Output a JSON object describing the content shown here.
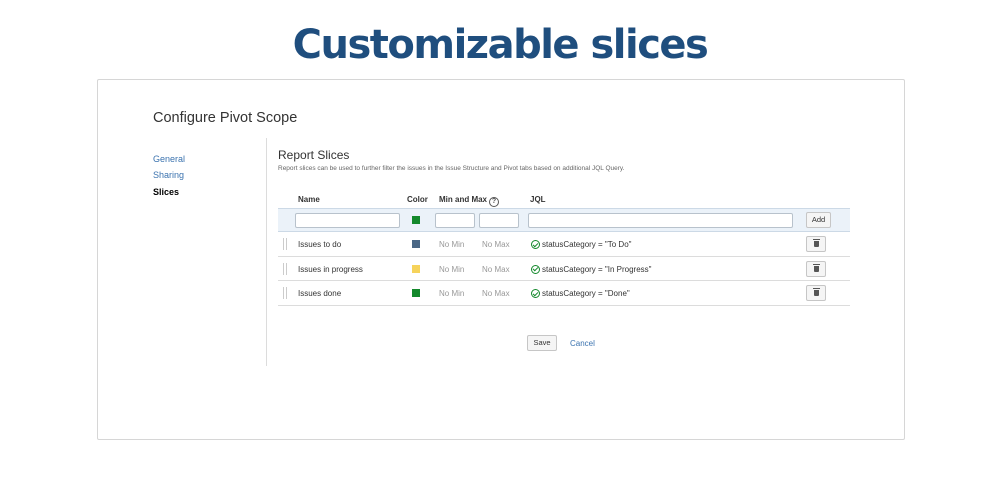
{
  "hero": {
    "title": "Customizable slices"
  },
  "page": {
    "heading": "Configure Pivot Scope"
  },
  "nav": {
    "items": [
      {
        "label": "General",
        "active": false
      },
      {
        "label": "Sharing",
        "active": false
      },
      {
        "label": "Slices",
        "active": true
      }
    ]
  },
  "section": {
    "title": "Report Slices",
    "description": "Report slices can be used to further filter the issues in the Issue Structure and Pivot tabs based on additional JQL Query."
  },
  "table": {
    "headers": {
      "name": "Name",
      "color": "Color",
      "minmax": "Min and Max",
      "jql": "JQL"
    },
    "new_row": {
      "name": "",
      "color": "#14892c",
      "min": "",
      "max": "",
      "jql": "",
      "add_label": "Add"
    },
    "rows": [
      {
        "name": "Issues to do",
        "color": "#4a6785",
        "min": "No Min",
        "max": "No Max",
        "jql": "statusCategory = \"To Do\""
      },
      {
        "name": "Issues in progress",
        "color": "#f6d35b",
        "min": "No Min",
        "max": "No Max",
        "jql": "statusCategory = \"In Progress\""
      },
      {
        "name": "Issues done",
        "color": "#14892c",
        "min": "No Min",
        "max": "No Max",
        "jql": "statusCategory = \"Done\""
      }
    ]
  },
  "actions": {
    "save_label": "Save",
    "cancel_label": "Cancel"
  },
  "icons": {
    "help": "question-circle-icon",
    "valid": "check-circle-icon",
    "delete": "trash-icon",
    "drag": "drag-handle-icon"
  },
  "colors": {
    "title": "#1f4e7e",
    "link": "#3b73af",
    "valid": "#14892c"
  }
}
